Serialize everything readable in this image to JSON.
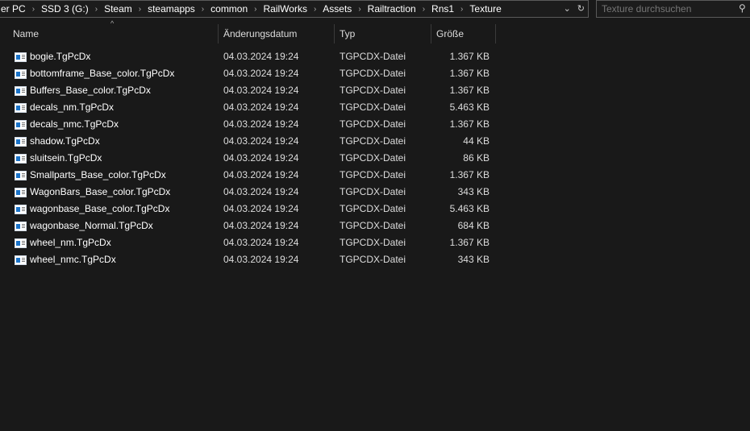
{
  "breadcrumb": [
    "er PC",
    "SSD 3 (G:)",
    "Steam",
    "steamapps",
    "common",
    "RailWorks",
    "Assets",
    "Railtraction",
    "Rns1",
    "Texture"
  ],
  "search": {
    "placeholder": "Texture durchsuchen"
  },
  "columns": {
    "name": "Name",
    "date": "Änderungsdatum",
    "type": "Typ",
    "size": "Größe"
  },
  "files": [
    {
      "name": "bogie.TgPcDx",
      "date": "04.03.2024 19:24",
      "type": "TGPCDX-Datei",
      "size": "1.367 KB"
    },
    {
      "name": "bottomframe_Base_color.TgPcDx",
      "date": "04.03.2024 19:24",
      "type": "TGPCDX-Datei",
      "size": "1.367 KB"
    },
    {
      "name": "Buffers_Base_color.TgPcDx",
      "date": "04.03.2024 19:24",
      "type": "TGPCDX-Datei",
      "size": "1.367 KB"
    },
    {
      "name": "decals_nm.TgPcDx",
      "date": "04.03.2024 19:24",
      "type": "TGPCDX-Datei",
      "size": "5.463 KB"
    },
    {
      "name": "decals_nmc.TgPcDx",
      "date": "04.03.2024 19:24",
      "type": "TGPCDX-Datei",
      "size": "1.367 KB"
    },
    {
      "name": "shadow.TgPcDx",
      "date": "04.03.2024 19:24",
      "type": "TGPCDX-Datei",
      "size": "44 KB"
    },
    {
      "name": "sluitsein.TgPcDx",
      "date": "04.03.2024 19:24",
      "type": "TGPCDX-Datei",
      "size": "86 KB"
    },
    {
      "name": "Smallparts_Base_color.TgPcDx",
      "date": "04.03.2024 19:24",
      "type": "TGPCDX-Datei",
      "size": "1.367 KB"
    },
    {
      "name": "WagonBars_Base_color.TgPcDx",
      "date": "04.03.2024 19:24",
      "type": "TGPCDX-Datei",
      "size": "343 KB"
    },
    {
      "name": "wagonbase_Base_color.TgPcDx",
      "date": "04.03.2024 19:24",
      "type": "TGPCDX-Datei",
      "size": "5.463 KB"
    },
    {
      "name": "wagonbase_Normal.TgPcDx",
      "date": "04.03.2024 19:24",
      "type": "TGPCDX-Datei",
      "size": "684 KB"
    },
    {
      "name": "wheel_nm.TgPcDx",
      "date": "04.03.2024 19:24",
      "type": "TGPCDX-Datei",
      "size": "1.367 KB"
    },
    {
      "name": "wheel_nmc.TgPcDx",
      "date": "04.03.2024 19:24",
      "type": "TGPCDX-Datei",
      "size": "343 KB"
    }
  ]
}
